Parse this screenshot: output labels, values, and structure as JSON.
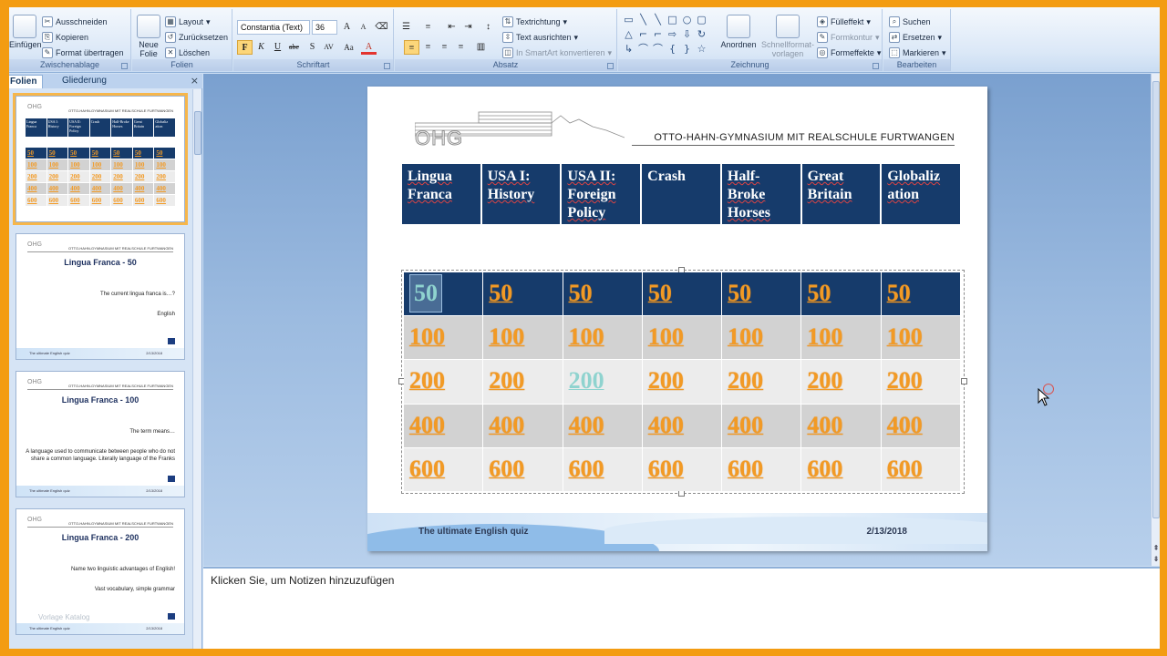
{
  "ribbon": {
    "clipboard": {
      "paste": "Einfügen",
      "cut": "Ausschneiden",
      "copy": "Kopieren",
      "format_painter": "Format übertragen",
      "label": "Zwischenablage"
    },
    "slides": {
      "new_slide": "Neue Folie",
      "layout": "Layout",
      "reset": "Zurücksetzen",
      "delete": "Löschen",
      "label": "Folien"
    },
    "font": {
      "font_name": "Constantia (Text)",
      "font_size": "36",
      "label": "Schriftart",
      "bold": "F",
      "italic": "K",
      "underline": "U",
      "strike": "abe",
      "shadow": "S",
      "spacing": "AV",
      "case": "Aa",
      "color": "A"
    },
    "paragraph": {
      "text_direction": "Textrichtung",
      "align_text": "Text ausrichten",
      "smartart": "In SmartArt konvertieren",
      "label": "Absatz"
    },
    "drawing": {
      "arrange": "Anordnen",
      "quick_styles": "Schnellformat-vorlagen",
      "fill": "Fülleffekt",
      "outline": "Formkontur",
      "effects": "Formeffekte",
      "label": "Zeichnung"
    },
    "editing": {
      "find": "Suchen",
      "replace": "Ersetzen",
      "select": "Markieren",
      "label": "Bearbeiten"
    }
  },
  "pane": {
    "tabs": [
      "Folien",
      "Gliederung"
    ],
    "close": "×",
    "thumbs": [
      {
        "type": "board",
        "categories": [
          "Lingua Franca",
          "USA I: History",
          "USA II: Foreign Policy",
          "Crash",
          "Half-Broke Horses",
          "Great Britain",
          "Globaliz ation"
        ],
        "rows": [
          "50",
          "100",
          "200",
          "400",
          "600"
        ]
      },
      {
        "type": "question",
        "title": "Lingua Franca  - 50",
        "question": "The current lingua franca is…?",
        "answer": "English",
        "footer_left": "The ultimate English quiz",
        "footer_right": "2/13/2018"
      },
      {
        "type": "question",
        "title": "Lingua Franca  - 100",
        "question": "The term means…",
        "answer": "A language  used to communicate between people who do not share a common language. Literally language of the Franks",
        "footer_left": "The ultimate English quiz",
        "footer_right": "2/13/2018"
      },
      {
        "type": "question",
        "title": "Lingua Franca  - 200",
        "question": "Name two linguistic advantages of English!",
        "answer": "Vast vocabulary, simple grammar",
        "watermark": "Vorlage Katalog",
        "footer_left": "The ultimate English quiz",
        "footer_right": "2/13/2018"
      }
    ]
  },
  "slide": {
    "logo": "OHG",
    "school": "OTTO-HAHN-GYMNASIUM MIT REALSCHULE FURTWANGEN",
    "categories": [
      "Lingua Franca",
      "USA I: History",
      "USA II: Foreign Policy",
      "Crash",
      "Half-Broke Horses",
      "Great Britain",
      "Globaliz ation"
    ],
    "values": [
      "50",
      "100",
      "200",
      "400",
      "600"
    ],
    "footer_left": "The ultimate English quiz",
    "footer_right": "2/13/2018"
  },
  "notes": {
    "placeholder": "Klicken Sie, um  Notizen hinzuzufügen"
  },
  "colors": {
    "board_header": "#163b6b",
    "points": "#f29a25",
    "visited": "#8fd3cf",
    "accent": "#f39c12"
  }
}
